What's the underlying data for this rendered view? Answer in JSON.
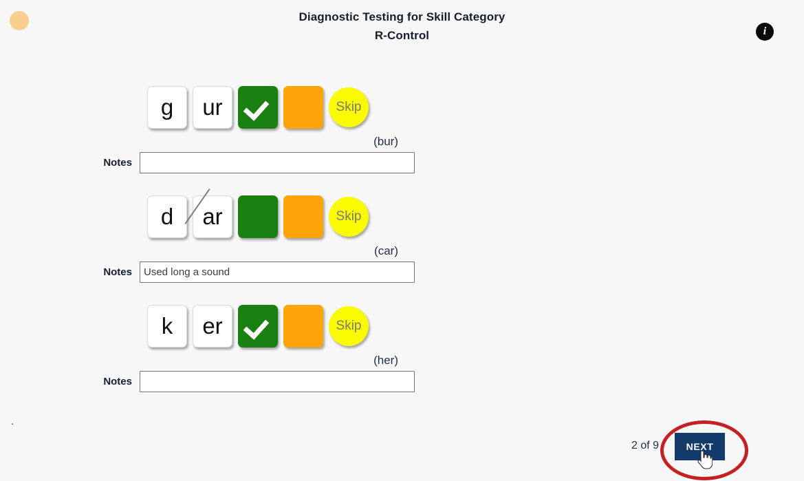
{
  "header": {
    "title_line1": "Diagnostic Testing for Skill Category",
    "title_line2": "R-Control",
    "info_icon_label": "i",
    "avatar_color": "#F8CE8F"
  },
  "colors": {
    "background": "#F7F7F7",
    "correct_green": "#1A8012",
    "incorrect_orange": "#FFA50A",
    "skip_yellow": "#FAFA00",
    "next_navy": "#123A6B",
    "annotation_red": "#C32222"
  },
  "notes_label": "Notes",
  "items": [
    {
      "phoneme_tiles": [
        "g",
        "ur"
      ],
      "struck_tile_index": null,
      "correct_checked": true,
      "incorrect_checked": false,
      "skip_label": "Skip",
      "word": "(bur)",
      "notes_value": "",
      "notes_placeholder": ""
    },
    {
      "phoneme_tiles": [
        "d",
        "ar"
      ],
      "struck_tile_index": 1,
      "correct_checked": false,
      "incorrect_checked": false,
      "skip_label": "Skip",
      "word": "(car)",
      "notes_value": "Used long a sound",
      "notes_placeholder": ""
    },
    {
      "phoneme_tiles": [
        "k",
        "er"
      ],
      "struck_tile_index": null,
      "correct_checked": true,
      "incorrect_checked": false,
      "skip_label": "Skip",
      "word": "(her)",
      "notes_value": "",
      "notes_placeholder": ""
    }
  ],
  "footer": {
    "stray_dot": ".",
    "pager": "2 of 9",
    "next_label": "NEXT"
  }
}
